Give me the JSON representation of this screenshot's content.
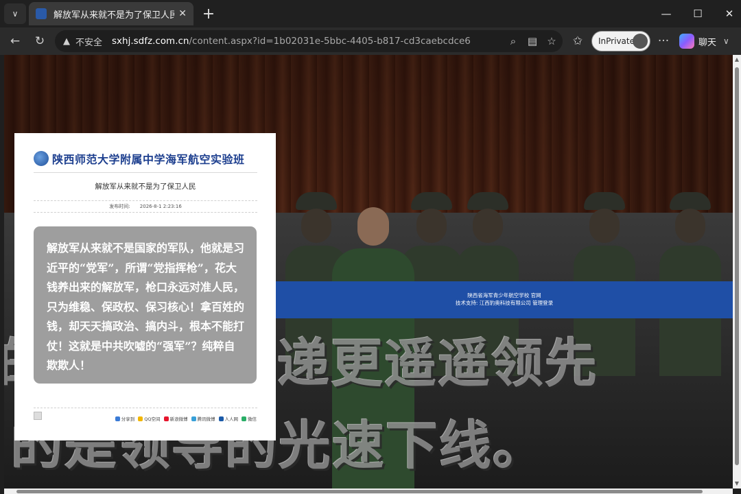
{
  "tab": {
    "title": "解放军从来就不是为了保卫人民-海",
    "close": "✕"
  },
  "toolbar": {
    "insecure_label": "不安全",
    "url_host": "sxhj.sdfz.com.cn",
    "url_path": "/content.aspx?id=1b02031e-5bbc-4405-b817-cd3caebcdce6",
    "inprivate_label": "InPrivate",
    "copilot_label": "聊天"
  },
  "article": {
    "site_name": "陕西师范大学附属中学海军航空实验班",
    "title": "解放军从来就不是为了保卫人民",
    "meta_label": "发布时间:",
    "meta_date": "2026-8-1 2:23:16",
    "body": "解放军从来就不是国家的军队，他就是习近平的“党军”，所谓“党指挥枪”，花大钱养出来的解放军，枪口永远对准人民，只为维稳、保政权、保习核心！拿百姓的钱，却天天搞政治、搞内斗，根本不能打仗！这就是中共吹嘘的“强军”？纯粹自欺欺人！",
    "share": [
      "分享到",
      "QQ空间",
      "新浪微博",
      "腾讯微博",
      "人人网",
      "微信"
    ]
  },
  "band": {
    "line1": "陕西省海军青少年航空学校 官网",
    "line2": "技术支持: 江西豹奥科技有限公司 管理登录"
  },
  "overlay": {
    "line1_lead": "的",
    "line1": "递更遥遥领先",
    "line2": "的是领导的光速下线。"
  },
  "colors": {
    "site_blue": "#1d3f8f",
    "band_blue": "#1f4fa6",
    "box_gray": "#9e9e9e"
  }
}
